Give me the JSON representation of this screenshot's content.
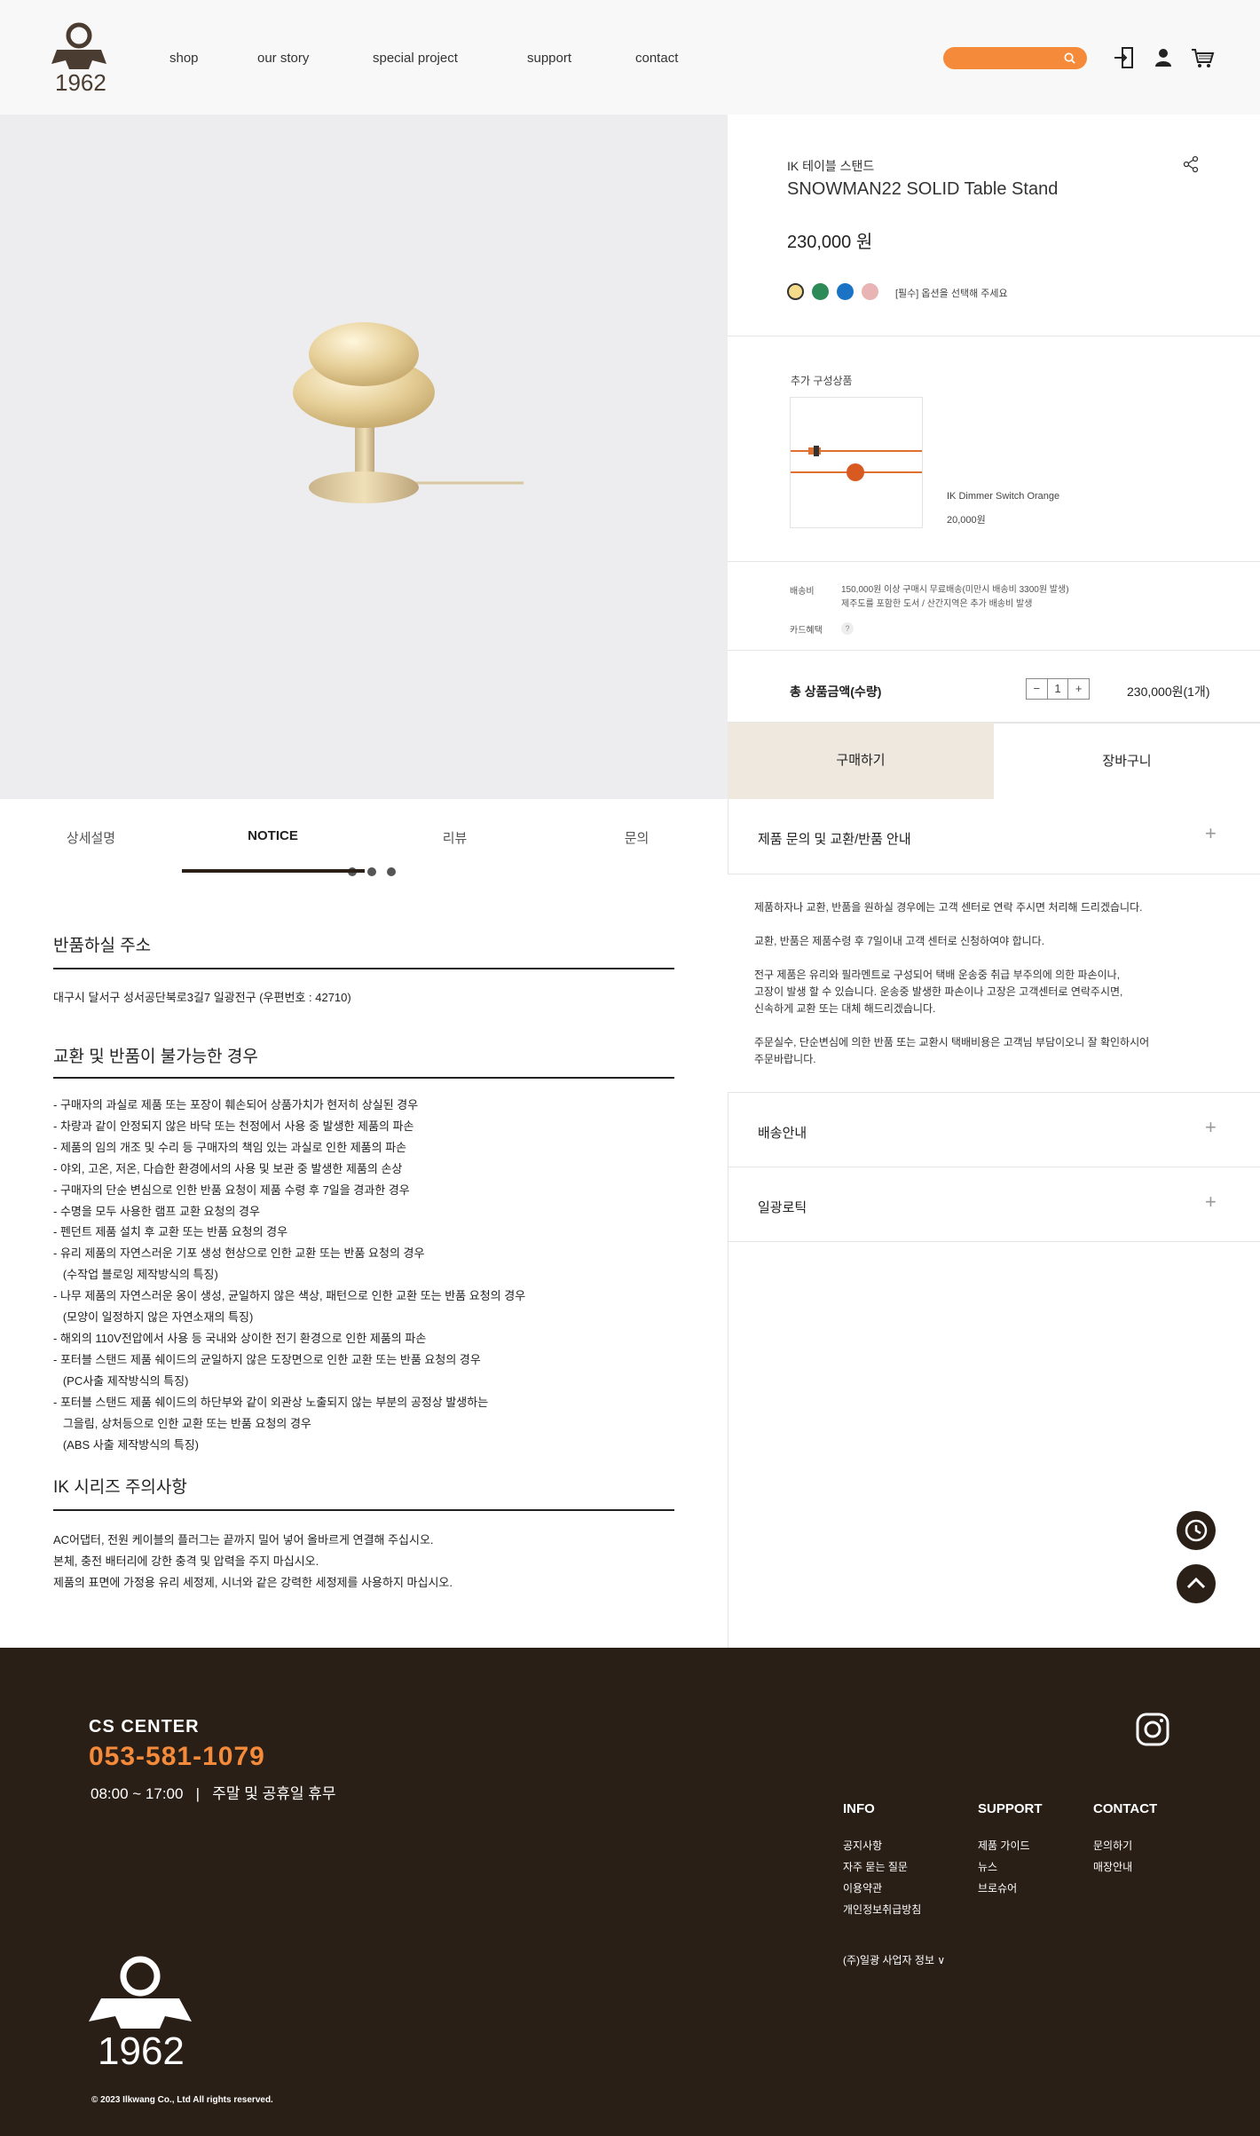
{
  "header": {
    "logo_text": "1962",
    "nav": [
      "shop",
      "our story",
      "special project",
      "support",
      "contact"
    ]
  },
  "product": {
    "category": "IK 테이블 스탠드",
    "name": "SNOWMAN22 SOLID Table Stand",
    "price": "230,000 원",
    "swatch_colors": [
      "#f5dc8a",
      "#2e8b57",
      "#1a73c4",
      "#e8b4b4"
    ],
    "option_note": "[필수] 옵션을 선택해 주세요",
    "carousel_dots": 4,
    "carousel_active": 0
  },
  "addon": {
    "title": "추가 구성상품",
    "name": "IK Dimmer Switch Orange",
    "price": "20,000원"
  },
  "shipping": {
    "label": "배송비",
    "line1": "150,000원 이상 구매시 무료배송(미만시 배송비 3300원 발생)",
    "line2": "제주도를 포함한 도서 / 산간지역은 추가 배송비 발생",
    "card_label": "카드혜택",
    "card_q": "?"
  },
  "total": {
    "label": "총 상품금액(수량)",
    "minus": "−",
    "qty": "1",
    "plus": "+",
    "value": "230,000원(1개)"
  },
  "buttons": {
    "buy": "구매하기",
    "cart": "장바구니"
  },
  "tabs": [
    "상세설명",
    "NOTICE",
    "리뷰",
    "문의"
  ],
  "notice": {
    "return_title": "반품하실 주소",
    "return_address": "대구시 달서구 성서공단북로3길7 일광전구 (우편번호 : 42710)",
    "unable_title": "교환 및 반품이 불가능한 경우",
    "unable_items": [
      "- 구매자의 과실로 제품 또는 포장이 훼손되어 상품가치가 현저히 상실된 경우",
      "- 차량과 같이 안정되지 않은 바닥 또는 천정에서 사용 중 발생한 제품의 파손",
      "- 제품의 임의 개조 및 수리 등 구매자의 책임 있는 과실로 인한 제품의 파손",
      "- 야외, 고온, 저온, 다습한 환경에서의 사용 및 보관 중 발생한 제품의 손상",
      "- 구매자의 단순 변심으로 인한 반품 요청이 제품 수령 후 7일을 경과한 경우",
      "- 수명을 모두 사용한 램프 교환 요청의 경우",
      "- 펜던트 제품 설치 후 교환 또는 반품 요청의 경우",
      "- 유리 제품의 자연스러운 기포 생성 현상으로 인한 교환 또는 반품 요청의 경우",
      "   (수작업 블로잉 제작방식의 특징)",
      "- 나무 제품의 자연스러운 옹이 생성, 균일하지 않은 색상, 패턴으로 인한 교환 또는 반품 요청의 경우",
      "   (모양이 일정하지 않은 자연소재의 특징)",
      "- 해외의 110V전압에서 사용 등 국내와 상이한 전기 환경으로 인한 제품의 파손",
      "- 포터블 스탠드 제품 쉐이드의 균일하지 않은 도장면으로 인한 교환 또는 반품 요청의 경우",
      "   (PC사출 제작방식의 특징)",
      "- 포터블 스탠드 제품 쉐이드의 하단부와 같이 외관상 노출되지 않는 부분의 공정상 발생하는",
      "   그을림, 상처등으로 인한 교환 또는 반품 요청의 경우",
      "   (ABS 사출 제작방식의 특징)"
    ],
    "ik_title": "IK 시리즈 주의사항",
    "ik_items": [
      "AC어댑터, 전원 케이블의 플러그는 끝까지 밀어 넣어 올바르게 연결해 주십시오.",
      "본체, 충전 배터리에 강한 충격 및 압력을 주지 마십시오.",
      "제품의 표면에 가정용 유리 세정제, 시너와 같은 강력한 세정제를 사용하지 마십시오."
    ]
  },
  "accordion": {
    "items": [
      "제품 문의 및 교환/반품 안내",
      "배송안내",
      "일광로틱"
    ],
    "plus": "+",
    "body": [
      "제품하자나 교환, 반품을 원하실 경우에는 고객 센터로 연락 주시면 처리해 드리겠습니다.",
      "",
      "교환, 반품은 제품수령 후 7일이내 고객 센터로 신청하여야 합니다.",
      "",
      "전구 제품은 유리와 필라멘트로 구성되어 택배 운송중 취급 부주의에 의한 파손이나,",
      "고장이 발생 할 수 있습니다. 운송중 발생한 파손이나 고장은 고객센터로 연락주시면,",
      "신속하게 교환 또는 대체 해드리겠습니다.",
      "",
      "주문실수, 단순변심에 의한 반품 또는 교환시 택배비용은 고객님 부담이오니 잘 확인하시어",
      "주문바랍니다."
    ]
  },
  "footer": {
    "cs_title": "CS  CENTER",
    "phone": "053-581-1079",
    "hours": "08:00 ~ 17:00   |   주말 및 공휴일 휴무",
    "info_title": "INFO",
    "info_links": [
      "공지사항",
      "자주 묻는 질문",
      "이용약관",
      "개인정보취급방침"
    ],
    "support_title": "SUPPORT",
    "support_links": [
      "제품 가이드",
      "뉴스",
      "브로슈어"
    ],
    "contact_title": "CONTACT",
    "contact_links": [
      "문의하기",
      "매장안내"
    ],
    "biz_info": "(주)일광 사업자 정보  ∨",
    "logo_text": "1962",
    "copyright": "© 2023 Ilkwang Co., Ltd All rights reserved."
  }
}
